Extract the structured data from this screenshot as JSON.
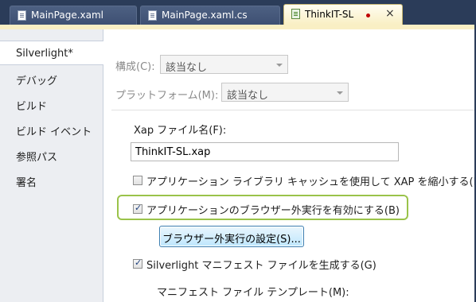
{
  "tabs": [
    {
      "label": "MainPage.xaml",
      "active": false
    },
    {
      "label": "MainPage.xaml.cs",
      "active": false
    },
    {
      "label": "ThinkIT-SL",
      "active": true,
      "modified_dot": true,
      "close": "×"
    }
  ],
  "sidebar": {
    "items": [
      {
        "label": "Silverlight*",
        "active": true
      },
      {
        "label": "デバッグ"
      },
      {
        "label": "ビルド"
      },
      {
        "label": "ビルド イベント"
      },
      {
        "label": "参照パス"
      },
      {
        "label": "署名"
      }
    ]
  },
  "config": {
    "label": "構成(C):",
    "value": "該当なし"
  },
  "platform": {
    "label": "プラットフォーム(M):",
    "value": "該当なし"
  },
  "xap": {
    "label": "Xap ファイル名(F):",
    "value": "ThinkIT-SL.xap"
  },
  "options": {
    "lib_cache": {
      "label": "アプリケーション ライブラリ キャッシュを使用して XAP を縮小する(R)",
      "checked": false
    },
    "oob_enable": {
      "label": "アプリケーションのブラウザー外実行を有効にする(B)",
      "checked": true
    },
    "oob_settings_button": "ブラウザー外実行の設定(S)...",
    "manifest": {
      "label": "Silverlight マニフェスト ファイルを生成する(G)",
      "checked": true
    },
    "manifest_template_label": "マニフェスト ファイル テンプレート(M):"
  },
  "colors": {
    "highlight": "#9ac34a",
    "tab_bg": "#2b3c59",
    "active_tab": "#f9efc4"
  }
}
